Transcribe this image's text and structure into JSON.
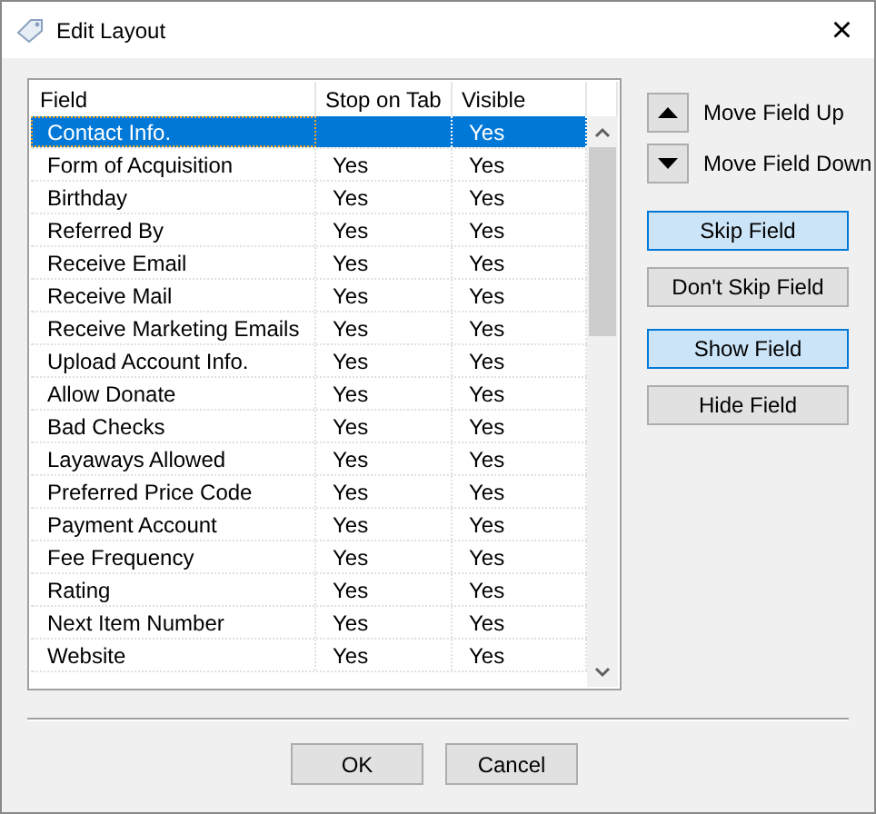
{
  "window": {
    "title": "Edit Layout",
    "close": "×"
  },
  "table": {
    "columns": [
      "Field",
      "Stop on Tab",
      "Visible"
    ],
    "rows": [
      {
        "field": "Contact Info.",
        "stop_on_tab": "",
        "visible": "Yes",
        "selected": true
      },
      {
        "field": "Form of Acquisition",
        "stop_on_tab": "Yes",
        "visible": "Yes",
        "selected": false
      },
      {
        "field": "Birthday",
        "stop_on_tab": "Yes",
        "visible": "Yes",
        "selected": false
      },
      {
        "field": "Referred By",
        "stop_on_tab": "Yes",
        "visible": "Yes",
        "selected": false
      },
      {
        "field": "Receive Email",
        "stop_on_tab": "Yes",
        "visible": "Yes",
        "selected": false
      },
      {
        "field": "Receive Mail",
        "stop_on_tab": "Yes",
        "visible": "Yes",
        "selected": false
      },
      {
        "field": "Receive Marketing Emails",
        "stop_on_tab": "Yes",
        "visible": "Yes",
        "selected": false
      },
      {
        "field": "Upload Account Info.",
        "stop_on_tab": "Yes",
        "visible": "Yes",
        "selected": false
      },
      {
        "field": "Allow Donate",
        "stop_on_tab": "Yes",
        "visible": "Yes",
        "selected": false
      },
      {
        "field": "Bad Checks",
        "stop_on_tab": "Yes",
        "visible": "Yes",
        "selected": false
      },
      {
        "field": "Layaways Allowed",
        "stop_on_tab": "Yes",
        "visible": "Yes",
        "selected": false
      },
      {
        "field": "Preferred Price Code",
        "stop_on_tab": "Yes",
        "visible": "Yes",
        "selected": false
      },
      {
        "field": "Payment Account",
        "stop_on_tab": "Yes",
        "visible": "Yes",
        "selected": false
      },
      {
        "field": "Fee Frequency",
        "stop_on_tab": "Yes",
        "visible": "Yes",
        "selected": false
      },
      {
        "field": "Rating",
        "stop_on_tab": "Yes",
        "visible": "Yes",
        "selected": false
      },
      {
        "field": "Next Item Number",
        "stop_on_tab": "Yes",
        "visible": "Yes",
        "selected": false
      },
      {
        "field": "Website",
        "stop_on_tab": "Yes",
        "visible": "Yes",
        "selected": false
      }
    ]
  },
  "move_buttons": [
    {
      "kind": "up",
      "label": "Move Field Up"
    },
    {
      "kind": "down",
      "label": "Move Field Down"
    }
  ],
  "action_groups": [
    [
      {
        "label": "Skip Field",
        "highlighted": true
      },
      {
        "label": "Don't Skip Field",
        "highlighted": false
      }
    ],
    [
      {
        "label": "Show Field",
        "highlighted": true
      },
      {
        "label": "Hide Field",
        "highlighted": false
      }
    ]
  ],
  "footer_buttons": [
    "OK",
    "Cancel"
  ]
}
